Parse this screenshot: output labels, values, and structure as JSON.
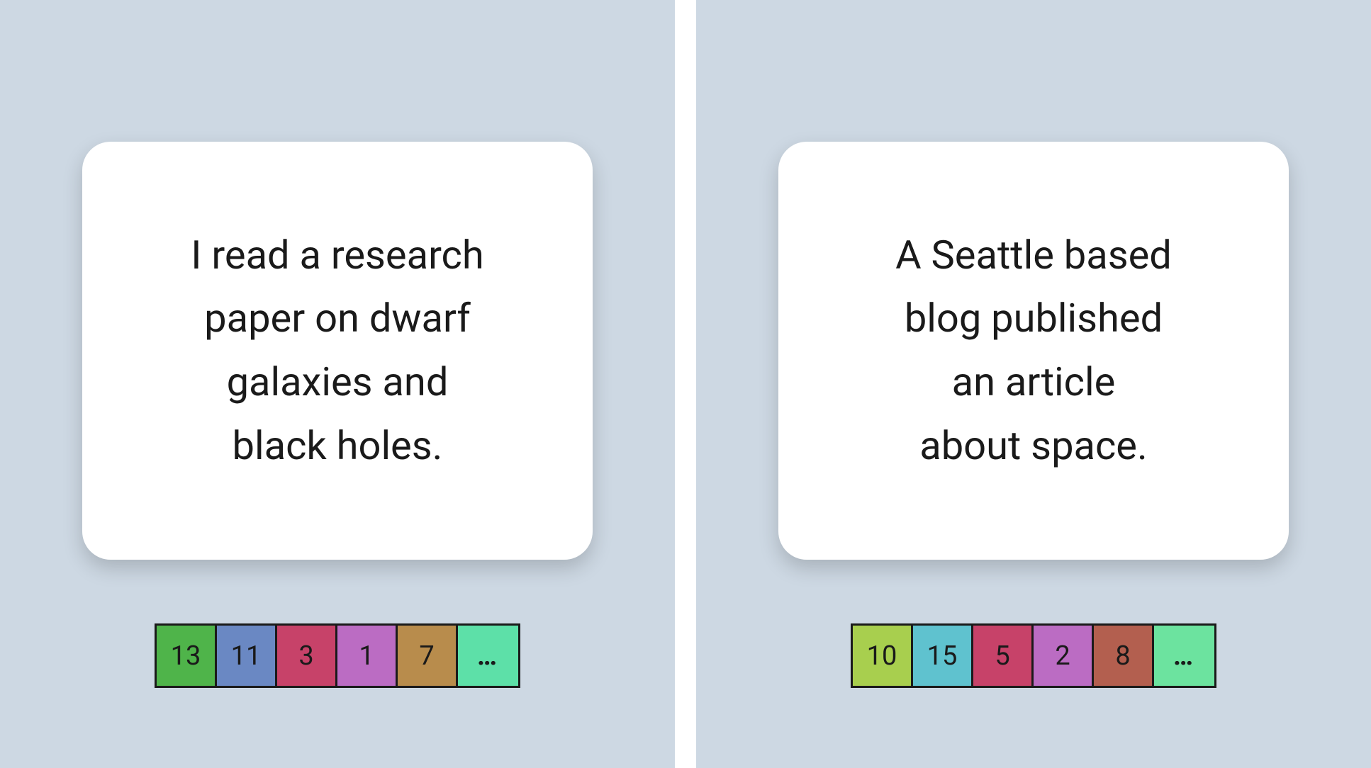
{
  "left": {
    "card_text": "I read a research\npaper on  dwarf\ngalaxies and\nblack holes.",
    "tokens": [
      {
        "value": "13",
        "color": "#4fb44a"
      },
      {
        "value": "11",
        "color": "#6a88c3"
      },
      {
        "value": "3",
        "color": "#c74269"
      },
      {
        "value": "1",
        "color": "#bb6cc3"
      },
      {
        "value": "7",
        "color": "#b88c4c"
      },
      {
        "value": "…",
        "color": "#5de0a8",
        "ellipsis": true
      }
    ]
  },
  "right": {
    "card_text": "A Seattle based\nblog published\nan article\nabout space.",
    "tokens": [
      {
        "value": "10",
        "color": "#a8cf4e"
      },
      {
        "value": "15",
        "color": "#5fc2cf"
      },
      {
        "value": "5",
        "color": "#c74269"
      },
      {
        "value": "2",
        "color": "#bb6cc3"
      },
      {
        "value": "8",
        "color": "#b35f4f"
      },
      {
        "value": "…",
        "color": "#6ce39f",
        "ellipsis": true
      }
    ]
  }
}
